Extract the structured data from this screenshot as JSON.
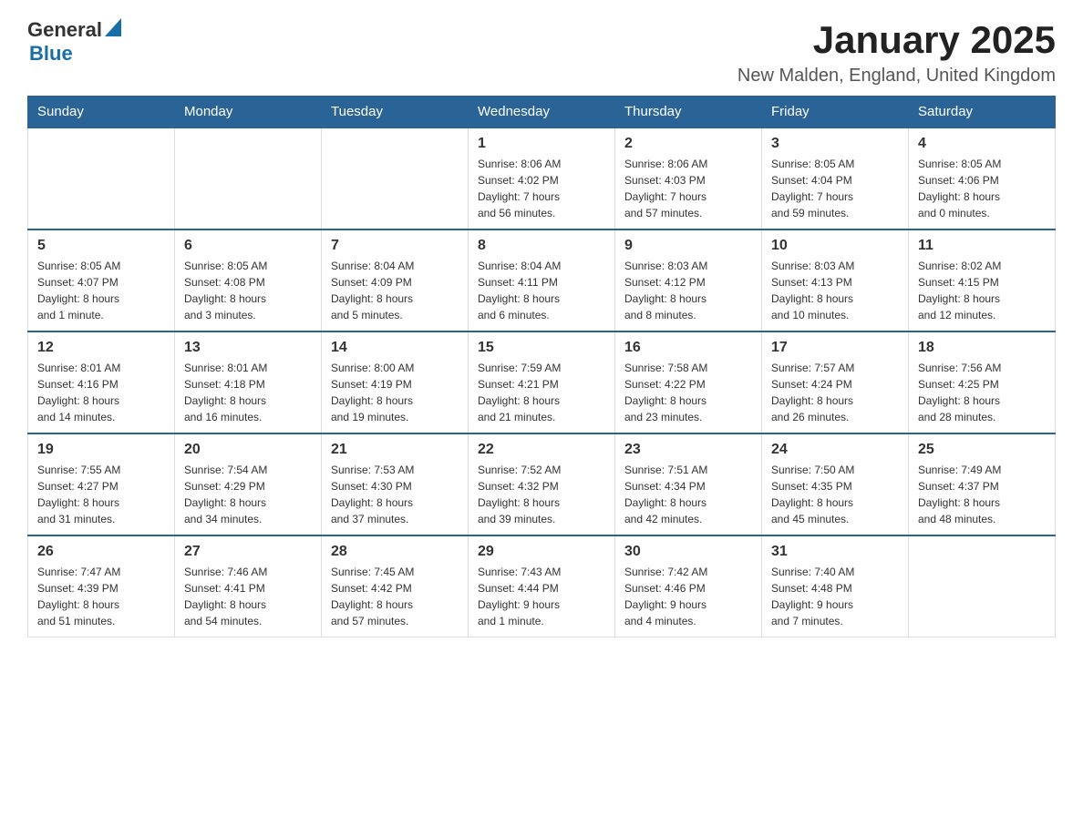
{
  "header": {
    "logo_general": "General",
    "logo_blue": "Blue",
    "title": "January 2025",
    "subtitle": "New Malden, England, United Kingdom"
  },
  "days_of_week": [
    "Sunday",
    "Monday",
    "Tuesday",
    "Wednesday",
    "Thursday",
    "Friday",
    "Saturday"
  ],
  "weeks": [
    [
      {
        "day": "",
        "info": ""
      },
      {
        "day": "",
        "info": ""
      },
      {
        "day": "",
        "info": ""
      },
      {
        "day": "1",
        "info": "Sunrise: 8:06 AM\nSunset: 4:02 PM\nDaylight: 7 hours\nand 56 minutes."
      },
      {
        "day": "2",
        "info": "Sunrise: 8:06 AM\nSunset: 4:03 PM\nDaylight: 7 hours\nand 57 minutes."
      },
      {
        "day": "3",
        "info": "Sunrise: 8:05 AM\nSunset: 4:04 PM\nDaylight: 7 hours\nand 59 minutes."
      },
      {
        "day": "4",
        "info": "Sunrise: 8:05 AM\nSunset: 4:06 PM\nDaylight: 8 hours\nand 0 minutes."
      }
    ],
    [
      {
        "day": "5",
        "info": "Sunrise: 8:05 AM\nSunset: 4:07 PM\nDaylight: 8 hours\nand 1 minute."
      },
      {
        "day": "6",
        "info": "Sunrise: 8:05 AM\nSunset: 4:08 PM\nDaylight: 8 hours\nand 3 minutes."
      },
      {
        "day": "7",
        "info": "Sunrise: 8:04 AM\nSunset: 4:09 PM\nDaylight: 8 hours\nand 5 minutes."
      },
      {
        "day": "8",
        "info": "Sunrise: 8:04 AM\nSunset: 4:11 PM\nDaylight: 8 hours\nand 6 minutes."
      },
      {
        "day": "9",
        "info": "Sunrise: 8:03 AM\nSunset: 4:12 PM\nDaylight: 8 hours\nand 8 minutes."
      },
      {
        "day": "10",
        "info": "Sunrise: 8:03 AM\nSunset: 4:13 PM\nDaylight: 8 hours\nand 10 minutes."
      },
      {
        "day": "11",
        "info": "Sunrise: 8:02 AM\nSunset: 4:15 PM\nDaylight: 8 hours\nand 12 minutes."
      }
    ],
    [
      {
        "day": "12",
        "info": "Sunrise: 8:01 AM\nSunset: 4:16 PM\nDaylight: 8 hours\nand 14 minutes."
      },
      {
        "day": "13",
        "info": "Sunrise: 8:01 AM\nSunset: 4:18 PM\nDaylight: 8 hours\nand 16 minutes."
      },
      {
        "day": "14",
        "info": "Sunrise: 8:00 AM\nSunset: 4:19 PM\nDaylight: 8 hours\nand 19 minutes."
      },
      {
        "day": "15",
        "info": "Sunrise: 7:59 AM\nSunset: 4:21 PM\nDaylight: 8 hours\nand 21 minutes."
      },
      {
        "day": "16",
        "info": "Sunrise: 7:58 AM\nSunset: 4:22 PM\nDaylight: 8 hours\nand 23 minutes."
      },
      {
        "day": "17",
        "info": "Sunrise: 7:57 AM\nSunset: 4:24 PM\nDaylight: 8 hours\nand 26 minutes."
      },
      {
        "day": "18",
        "info": "Sunrise: 7:56 AM\nSunset: 4:25 PM\nDaylight: 8 hours\nand 28 minutes."
      }
    ],
    [
      {
        "day": "19",
        "info": "Sunrise: 7:55 AM\nSunset: 4:27 PM\nDaylight: 8 hours\nand 31 minutes."
      },
      {
        "day": "20",
        "info": "Sunrise: 7:54 AM\nSunset: 4:29 PM\nDaylight: 8 hours\nand 34 minutes."
      },
      {
        "day": "21",
        "info": "Sunrise: 7:53 AM\nSunset: 4:30 PM\nDaylight: 8 hours\nand 37 minutes."
      },
      {
        "day": "22",
        "info": "Sunrise: 7:52 AM\nSunset: 4:32 PM\nDaylight: 8 hours\nand 39 minutes."
      },
      {
        "day": "23",
        "info": "Sunrise: 7:51 AM\nSunset: 4:34 PM\nDaylight: 8 hours\nand 42 minutes."
      },
      {
        "day": "24",
        "info": "Sunrise: 7:50 AM\nSunset: 4:35 PM\nDaylight: 8 hours\nand 45 minutes."
      },
      {
        "day": "25",
        "info": "Sunrise: 7:49 AM\nSunset: 4:37 PM\nDaylight: 8 hours\nand 48 minutes."
      }
    ],
    [
      {
        "day": "26",
        "info": "Sunrise: 7:47 AM\nSunset: 4:39 PM\nDaylight: 8 hours\nand 51 minutes."
      },
      {
        "day": "27",
        "info": "Sunrise: 7:46 AM\nSunset: 4:41 PM\nDaylight: 8 hours\nand 54 minutes."
      },
      {
        "day": "28",
        "info": "Sunrise: 7:45 AM\nSunset: 4:42 PM\nDaylight: 8 hours\nand 57 minutes."
      },
      {
        "day": "29",
        "info": "Sunrise: 7:43 AM\nSunset: 4:44 PM\nDaylight: 9 hours\nand 1 minute."
      },
      {
        "day": "30",
        "info": "Sunrise: 7:42 AM\nSunset: 4:46 PM\nDaylight: 9 hours\nand 4 minutes."
      },
      {
        "day": "31",
        "info": "Sunrise: 7:40 AM\nSunset: 4:48 PM\nDaylight: 9 hours\nand 7 minutes."
      },
      {
        "day": "",
        "info": ""
      }
    ]
  ]
}
